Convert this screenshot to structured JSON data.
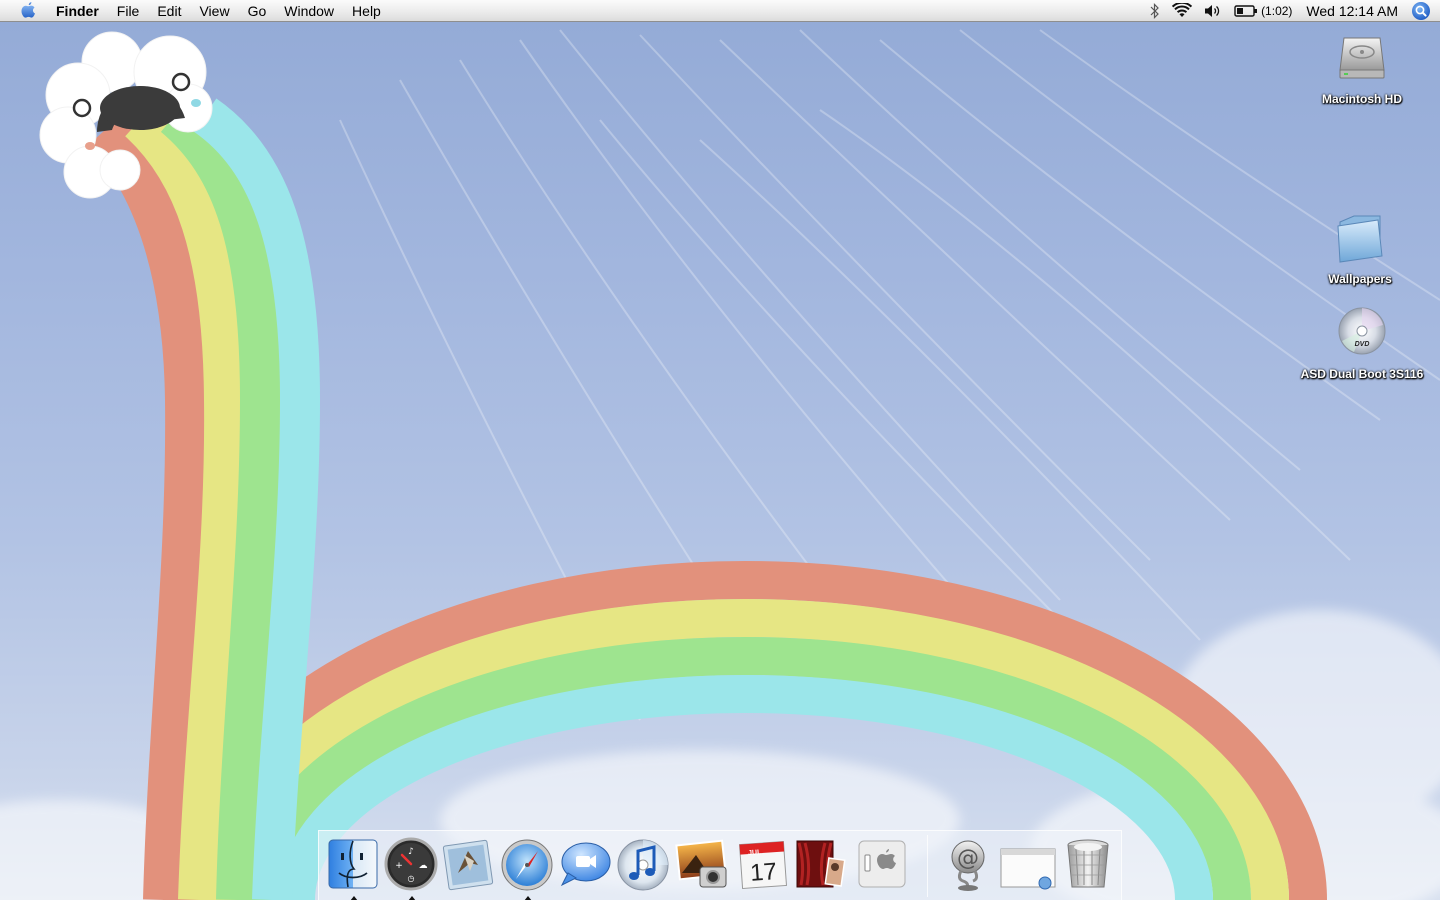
{
  "menubar": {
    "app_name": "Finder",
    "menus": [
      "File",
      "Edit",
      "View",
      "Go",
      "Window",
      "Help"
    ],
    "battery_time": "(1:02)",
    "clock": "Wed 12:14 AM",
    "icons": [
      "apple-icon",
      "bluetooth-icon",
      "wifi-icon",
      "volume-icon",
      "battery-icon",
      "spotlight-icon"
    ]
  },
  "desktop_icons": [
    {
      "label": "Macintosh HD",
      "icon": "hard-drive-icon"
    },
    {
      "label": "Wallpapers",
      "icon": "folder-icon"
    },
    {
      "label": "ASD Dual Boot 3S116",
      "icon": "dvd-icon"
    }
  ],
  "dock": {
    "apps": [
      {
        "name": "Finder",
        "icon": "finder-icon",
        "running": true
      },
      {
        "name": "Dashboard",
        "icon": "dashboard-icon",
        "running": true
      },
      {
        "name": "Mail",
        "icon": "mail-icon",
        "running": false
      },
      {
        "name": "Safari",
        "icon": "safari-icon",
        "running": true
      },
      {
        "name": "iChat",
        "icon": "ichat-icon",
        "running": false
      },
      {
        "name": "iTunes",
        "icon": "itunes-icon",
        "running": false
      },
      {
        "name": "iPhoto",
        "icon": "iphoto-icon",
        "running": false
      },
      {
        "name": "iCal",
        "icon": "ical-icon",
        "running": false
      },
      {
        "name": "Front Row",
        "icon": "front-row-icon",
        "running": false
      },
      {
        "name": "Boot Camp",
        "icon": "bootcamp-icon",
        "running": false
      }
    ],
    "others": [
      {
        "name": "Downloads",
        "icon": "at-sign-stack-icon"
      },
      {
        "name": "Minimized Window",
        "icon": "window-icon"
      },
      {
        "name": "Trash",
        "icon": "trash-icon"
      }
    ],
    "ical_month": "JUL",
    "ical_day": "17",
    "dvd_label": "DVD"
  },
  "colors": {
    "rainbow_red": "#e2917c",
    "rainbow_yellow": "#e6e684",
    "rainbow_green": "#9ee48f",
    "rainbow_cyan": "#9be6ea",
    "sky_top": "#93aad6",
    "sky_bottom": "#d7e0ef"
  }
}
